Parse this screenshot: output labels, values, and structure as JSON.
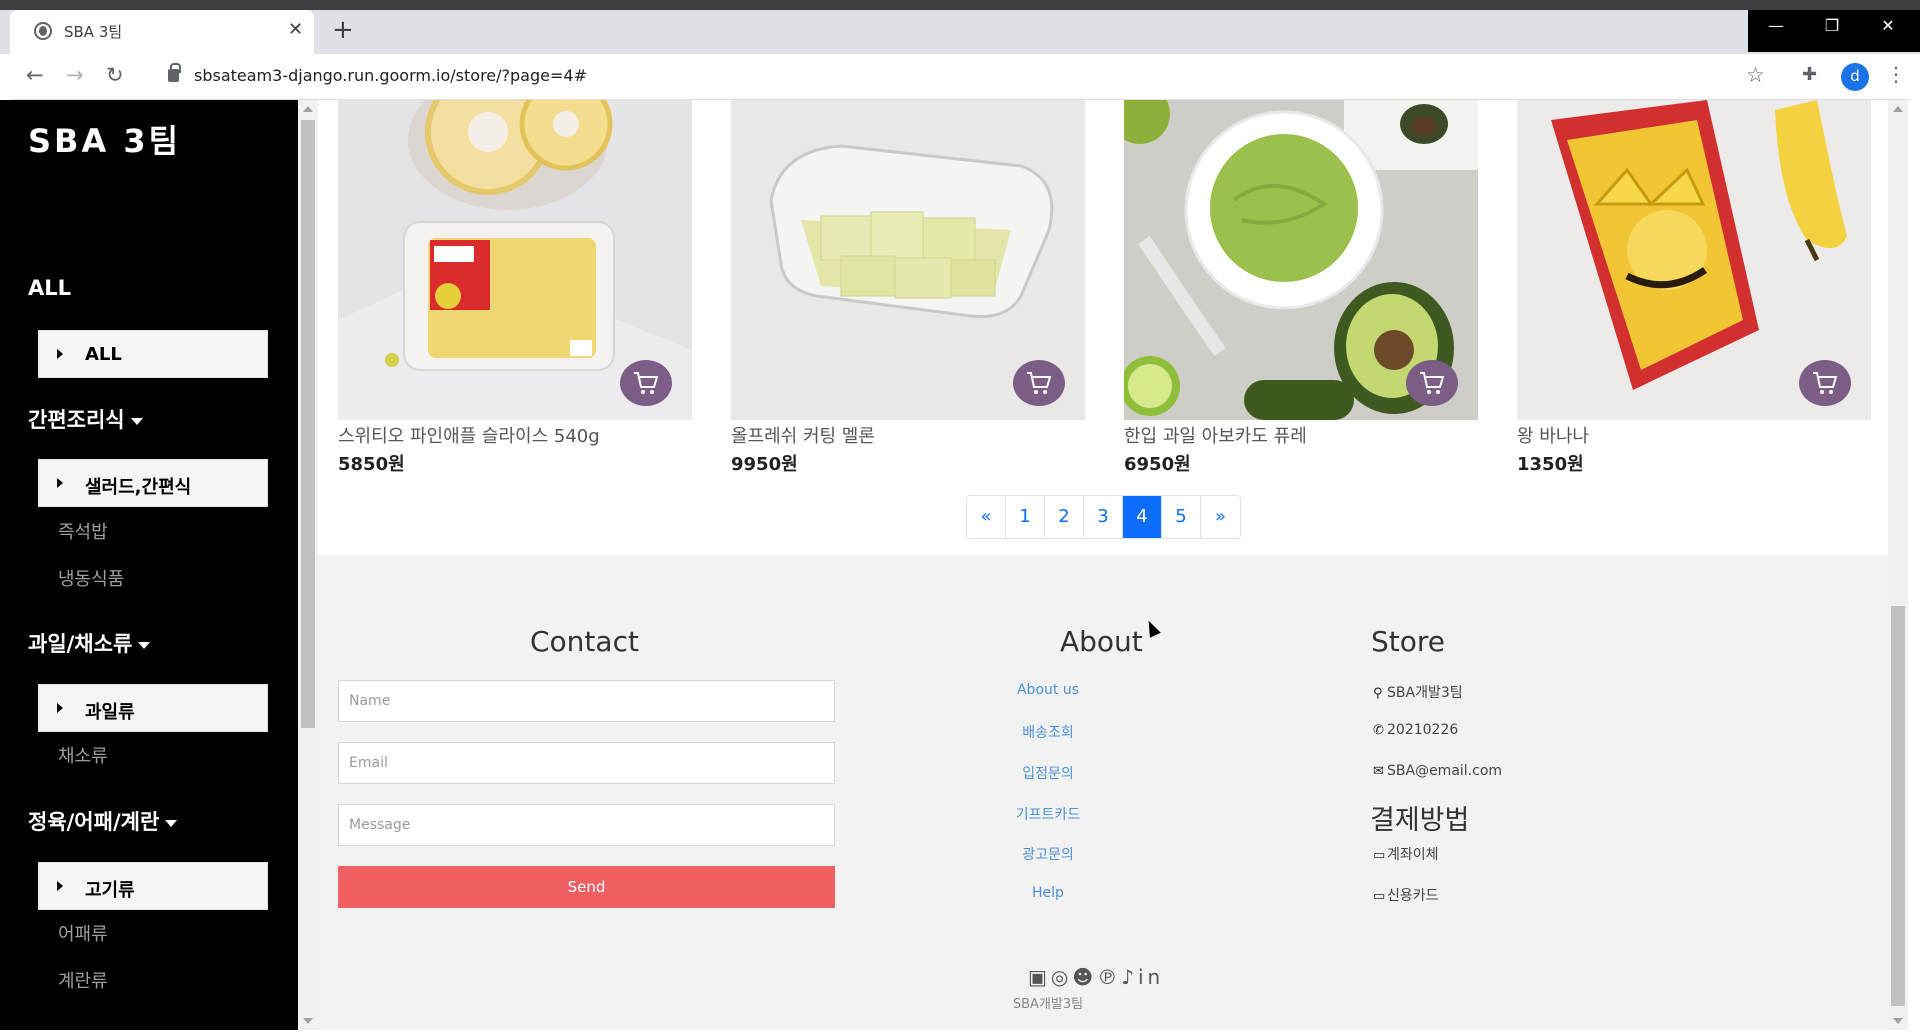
{
  "browser": {
    "tab_title": "SBA 3팀",
    "url": "sbsateam3-django.run.goorm.io/store/?page=4#",
    "profile_initial": "d",
    "icons": [
      "globe-icon",
      "close-icon",
      "plus-icon",
      "back-icon",
      "forward-icon",
      "reload-icon",
      "lock-icon",
      "star-icon",
      "extensions-icon",
      "menu-icon"
    ]
  },
  "sidebar": {
    "brand": "SBA 3팀",
    "categories": [
      {
        "heading": "ALL",
        "button": "ALL",
        "subs": []
      },
      {
        "heading": "간편조리식",
        "button": "샐러드,간편식",
        "subs": [
          "즉석밥",
          "냉동식품"
        ]
      },
      {
        "heading": "과일/채소류",
        "button": "과일류",
        "subs": [
          "채소류"
        ]
      },
      {
        "heading": "정육/어패/계란",
        "button": "고기류",
        "subs": [
          "어패류",
          "계란류"
        ]
      }
    ]
  },
  "products": [
    {
      "name": "스위티오 파인애플 슬라이스 540g",
      "price": "5850원"
    },
    {
      "name": "올프레쉬 커팅 멜론",
      "price": "9950원"
    },
    {
      "name": "한입 과일 아보카도 퓨레",
      "price": "6950원"
    },
    {
      "name": "왕 바나나",
      "price": "1350원"
    }
  ],
  "pagination": {
    "prev": "«",
    "pages": [
      "1",
      "2",
      "3",
      "4",
      "5"
    ],
    "next": "»",
    "current": "4"
  },
  "footer": {
    "contact": {
      "title": "Contact",
      "name_placeholder": "Name",
      "email_placeholder": "Email",
      "message_placeholder": "Message",
      "send_label": "Send"
    },
    "about": {
      "title": "About",
      "links": [
        "About us",
        "배송조회",
        "입점문의",
        "기프트카드",
        "광고문의",
        "Help"
      ]
    },
    "store": {
      "title": "Store",
      "address": "SBA개발3팀",
      "phone": "20210226",
      "email": "SBA@email.com",
      "payment_title": "결제방법",
      "payments": [
        "계좌이체",
        "신용카드"
      ]
    },
    "social": "facebook instagram snapchat pinterest twitter linkedin",
    "copyright": "SBA개발3팀"
  },
  "colors": {
    "active_page": "#0d6efd",
    "send_button": "#f05f61",
    "cart_button": "#7b5d86",
    "sidebar_bg": "#000000"
  }
}
